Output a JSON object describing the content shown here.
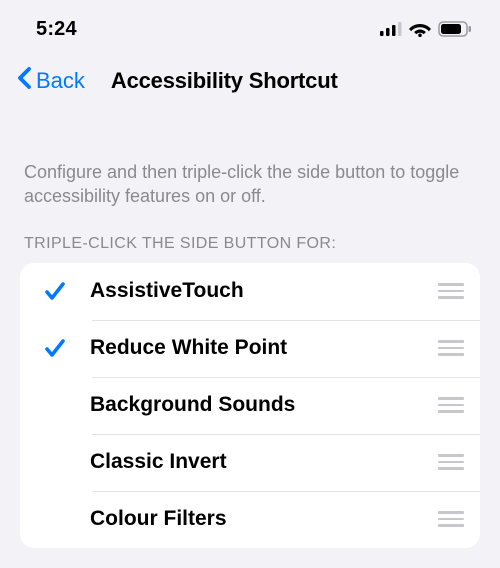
{
  "status": {
    "time": "5:24"
  },
  "nav": {
    "back_label": "Back",
    "title": "Accessibility Shortcut"
  },
  "section": {
    "description": "Configure and then triple-click the side button to toggle accessibility features on or off.",
    "header": "TRIPLE-CLICK THE SIDE BUTTON FOR:"
  },
  "items": [
    {
      "label": "AssistiveTouch",
      "checked": true
    },
    {
      "label": "Reduce White Point",
      "checked": true
    },
    {
      "label": "Background Sounds",
      "checked": false
    },
    {
      "label": "Classic Invert",
      "checked": false
    },
    {
      "label": "Colour Filters",
      "checked": false
    }
  ]
}
